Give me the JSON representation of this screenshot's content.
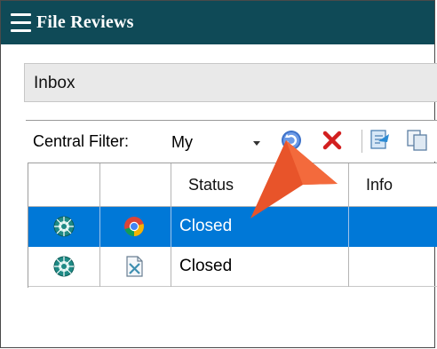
{
  "window": {
    "title": "File Reviews"
  },
  "inbox": {
    "label": "Inbox"
  },
  "toolbar": {
    "filter_label": "Central Filter:",
    "filter_value": "My",
    "icons": [
      "refresh-icon",
      "delete-icon",
      "open-review-icon",
      "copy-icon"
    ]
  },
  "grid": {
    "columns": [
      "",
      "",
      "Status",
      "Info"
    ],
    "rows": [
      {
        "status": "Closed",
        "icon": "browser-icon",
        "selected": true
      },
      {
        "status": "Closed",
        "icon": "xml-file-icon",
        "selected": false
      }
    ]
  },
  "colors": {
    "titlebar": "#0f4a57",
    "selection": "#0078d7",
    "callout": "#e8542a"
  }
}
